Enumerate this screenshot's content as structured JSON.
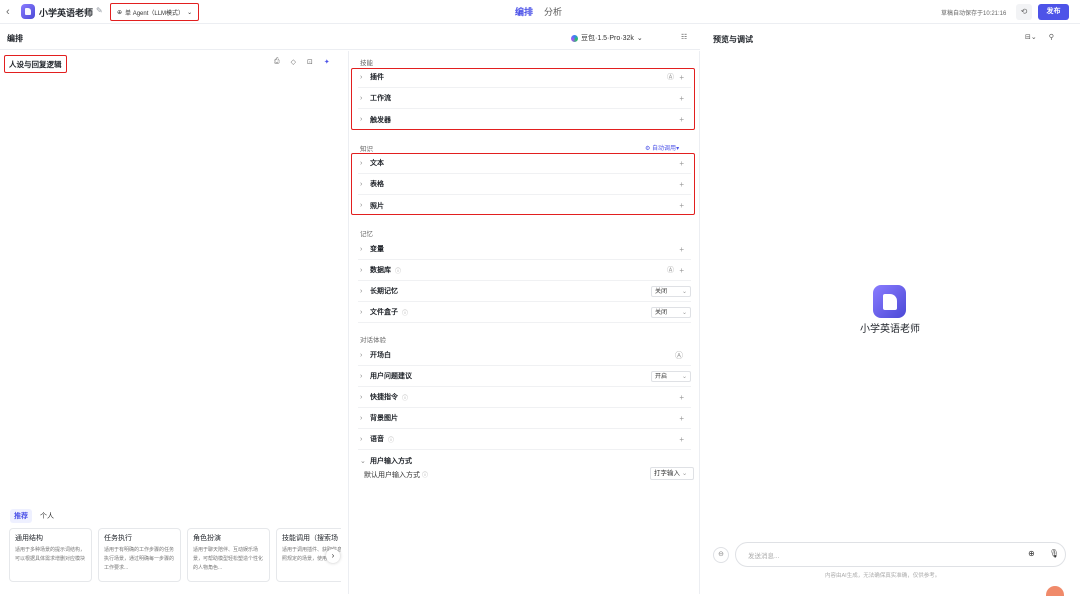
{
  "topbar": {
    "back": "‹",
    "title": "小学英语老师",
    "agent_mode": "单 Agent（LLM模式）",
    "tabs": [
      "编排",
      "分析"
    ],
    "saved": "草稿自动保存于10:21:16",
    "publish": "发布"
  },
  "subbar": {
    "title": "编排",
    "model": "豆包·1.5·Pro·32k"
  },
  "persona": {
    "title": "人设与回复逻辑"
  },
  "templates": {
    "tabs": [
      "推荐",
      "个人"
    ],
    "cards": [
      {
        "title": "通用结构",
        "desc": "适用于多种场景的提示词结构，可以根据具体需求增删对应模块"
      },
      {
        "title": "任务执行",
        "desc": "适用于有明确的工作步骤的任务执行场景，通过明确每一步骤的工作要求..."
      },
      {
        "title": "角色扮演",
        "desc": "适用于聊天陪伴、互动娱乐场景，可帮助模型轻松塑造个性化的人物角色..."
      },
      {
        "title": "技能调用（搜索场",
        "desc": "适用于调用插件、获取信息并按照规定的场景，使用时将"
      }
    ]
  },
  "skills": {
    "label": "技能",
    "items": [
      "插件",
      "工作流",
      "触发器"
    ]
  },
  "knowledge": {
    "label": "知识",
    "auto": "自动调用",
    "items": [
      "文本",
      "表格",
      "照片"
    ]
  },
  "memory": {
    "label": "记忆",
    "items": [
      {
        "label": "变量"
      },
      {
        "label": "数据库"
      },
      {
        "label": "长期记忆",
        "value": "关闭"
      },
      {
        "label": "文件盒子",
        "value": "关闭"
      }
    ]
  },
  "dialog": {
    "label": "对话体验",
    "items": [
      {
        "label": "开场白"
      },
      {
        "label": "用户问题建议",
        "value": "开启"
      },
      {
        "label": "快捷指令"
      },
      {
        "label": "背景图片"
      },
      {
        "label": "语音"
      },
      {
        "label": "用户输入方式"
      }
    ],
    "default_input_label": "默认用户输入方式",
    "default_input_value": "打字输入"
  },
  "preview": {
    "title": "预览与调试",
    "bot_name": "小学英语老师",
    "input_placeholder": "发送消息...",
    "disclaimer": "内容由AI生成，无法确保真实准确，仅供参考。"
  }
}
